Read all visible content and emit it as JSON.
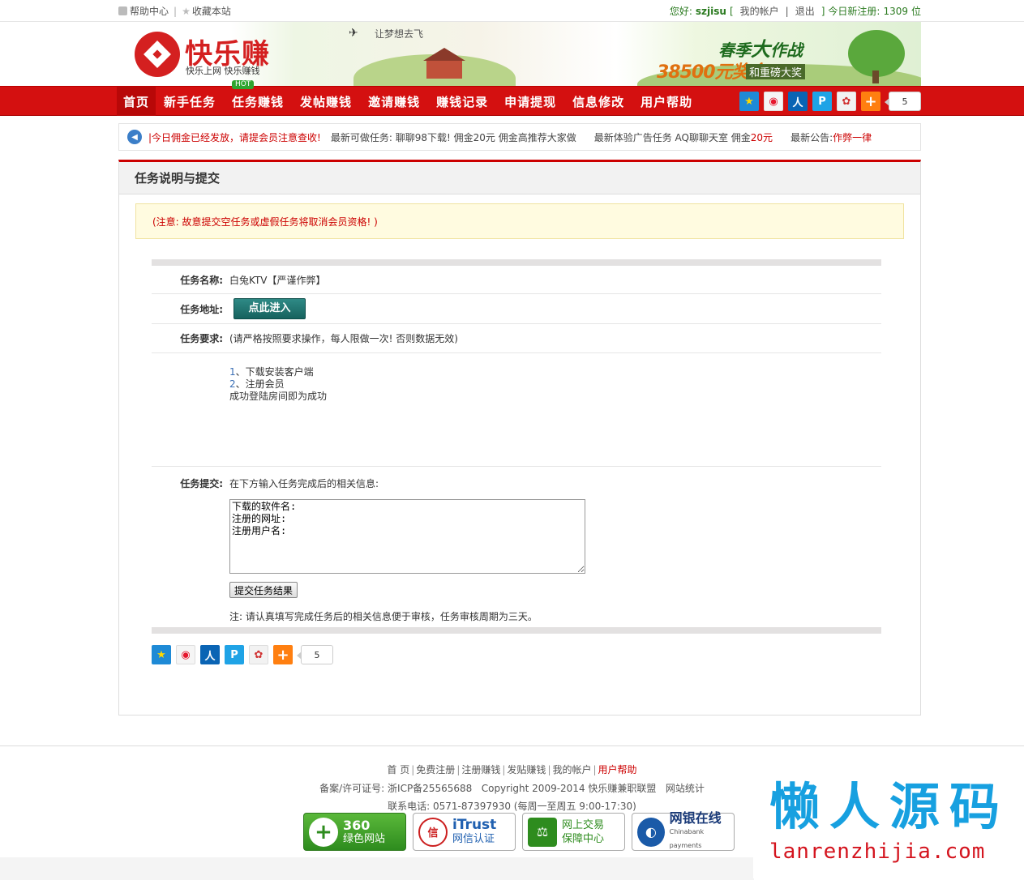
{
  "topbar": {
    "help": "帮助中心",
    "favorite": "收藏本站",
    "greeting": "您好:",
    "username": "szjisu",
    "bracket_open": "[",
    "account": "我的帐户",
    "divider": "|",
    "logout": "退出",
    "bracket_close": "]",
    "today_reg_label": "今日新注册:",
    "today_reg_count": "1309",
    "today_reg_unit": "位"
  },
  "header": {
    "logo_text": "快乐赚",
    "logo_sub": "快乐上网 快乐赚钱",
    "slogan": "让梦想去飞",
    "promo_title_a": "春季",
    "promo_title_b": "大",
    "promo_title_c": "作战",
    "promo_amount": "38500元奖金",
    "promo_extra": "和重磅大奖"
  },
  "nav": {
    "items": [
      {
        "label": "首页"
      },
      {
        "label": "新手任务"
      },
      {
        "label": "任务赚钱",
        "badge": "HOT"
      },
      {
        "label": "发帖赚钱"
      },
      {
        "label": "邀请赚钱"
      },
      {
        "label": "赚钱记录"
      },
      {
        "label": "申请提现"
      },
      {
        "label": "信息修改"
      },
      {
        "label": "用户帮助"
      }
    ],
    "share_count": "5"
  },
  "notice": {
    "n1": "|今日佣金已经发放，请提会员注意查收!",
    "n2": "最新可做任务: 聊聊98下载! 佣金20元 佣金高推荐大家做",
    "n3a": "最新体验广告任务 AQ聊聊天室 佣金",
    "n3b": "20元",
    "n4a": "最新公告:",
    "n4b": "作弊一律"
  },
  "panel": {
    "title": "任务说明与提交",
    "warning": "(注意: 故意提交空任务或虚假任务将取消会员资格! )",
    "task_name_label": "任务名称:",
    "task_name": "白兔KTV【严谨作弊】",
    "task_url_label": "任务地址:",
    "enter_button": "点此进入",
    "task_req_label": "任务要求:",
    "task_req": "(请严格按照要求操作，每人限做一次! 否则数据无效)",
    "steps": [
      {
        "num": "1",
        "text": "、下载安装客户端"
      },
      {
        "num": "2",
        "text": "、注册会员"
      },
      {
        "num": "",
        "text": "成功登陆房间即为成功"
      }
    ],
    "submit_label": "任务提交:",
    "submit_hint": "在下方输入任务完成后的相关信息:",
    "textarea_value": "下载的软件名:\n注册的网址:\n注册用户名:",
    "submit_button": "提交任务结果",
    "note": "注: 请认真填写完成任务后的相关信息便于审核，任务审核周期为三天。",
    "share_count": "5"
  },
  "footer": {
    "links": [
      "首 页",
      "免费注册",
      "注册赚钱",
      "发贴赚钱",
      "我的帐户"
    ],
    "help": "用户帮助",
    "icp": "备案/许可证号: 浙ICP备25565688",
    "copyright": "Copyright 2009-2014 快乐赚兼职联盟",
    "stats": "网站统计",
    "tel": "联系电话: 0571-87397930 (每周一至周五 9:00-17:30)",
    "badges": [
      {
        "t1": "360",
        "t2": "绿色网站"
      },
      {
        "t1": "iTrust",
        "t2": "网信认证"
      },
      {
        "t1": "网上交易",
        "t2": "保障中心"
      },
      {
        "t1": "网银在线",
        "t2": "Chinabank payments"
      }
    ]
  },
  "watermark": {
    "big": "懒人源码",
    "url": "lanrenzhijia.com"
  }
}
